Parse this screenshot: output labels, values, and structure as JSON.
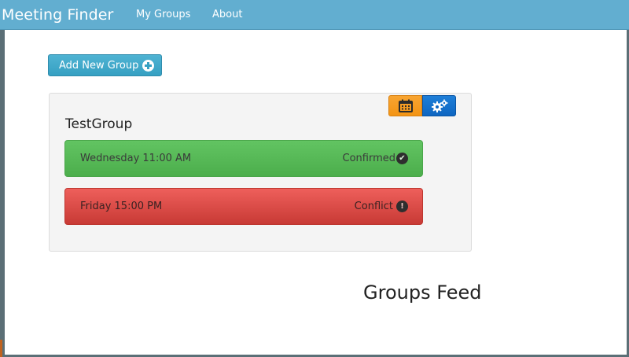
{
  "navbar": {
    "brand": "Meeting Finder",
    "links": [
      "My Groups",
      "About"
    ]
  },
  "actions": {
    "add_group_label": "Add New Group"
  },
  "group": {
    "name": "TestGroup",
    "toolbar": {
      "calendar_icon": "calendar-icon",
      "settings_icon": "gears-icon"
    },
    "slots": [
      {
        "time": "Wednesday 11:00 AM",
        "status": "Confirmed",
        "status_icon": "check-circle-icon",
        "color": "#5cb85c"
      },
      {
        "time": "Friday 15:00 PM",
        "status": "Conflict",
        "status_icon": "exclamation-circle-icon",
        "color": "#d9534f"
      }
    ]
  },
  "feed": {
    "title": "Groups Feed"
  },
  "colors": {
    "navbar": "#62aed0",
    "primary_button": "#36a0c2",
    "calendar_button": "#f39414",
    "settings_button": "#0e66c1"
  }
}
